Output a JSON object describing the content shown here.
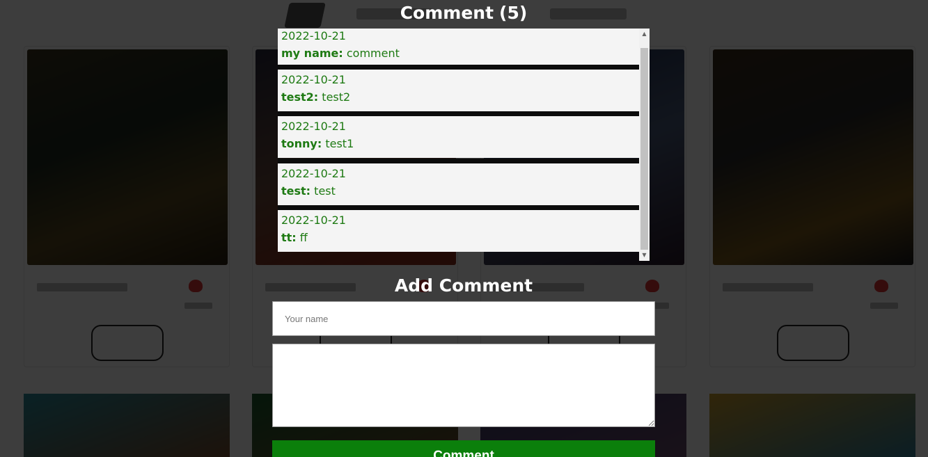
{
  "modal": {
    "title": "Comment",
    "count": "(5)",
    "comments": [
      {
        "date": "2022-10-21",
        "name": "my name:",
        "text": "comment"
      },
      {
        "date": "2022-10-21",
        "name": "test2:",
        "text": "test2"
      },
      {
        "date": "2022-10-21",
        "name": "tonny:",
        "text": "test1"
      },
      {
        "date": "2022-10-21",
        "name": "test:",
        "text": "test"
      },
      {
        "date": "2022-10-21",
        "name": "tt:",
        "text": "ff"
      }
    ],
    "add_title": "Add Comment",
    "name_placeholder": "Your name",
    "submit_label": "Comment"
  },
  "colors": {
    "comment_text": "#1e7a13",
    "submit_bg": "#0b7f0b",
    "overlay": "rgba(0,0,0,0.76)"
  }
}
